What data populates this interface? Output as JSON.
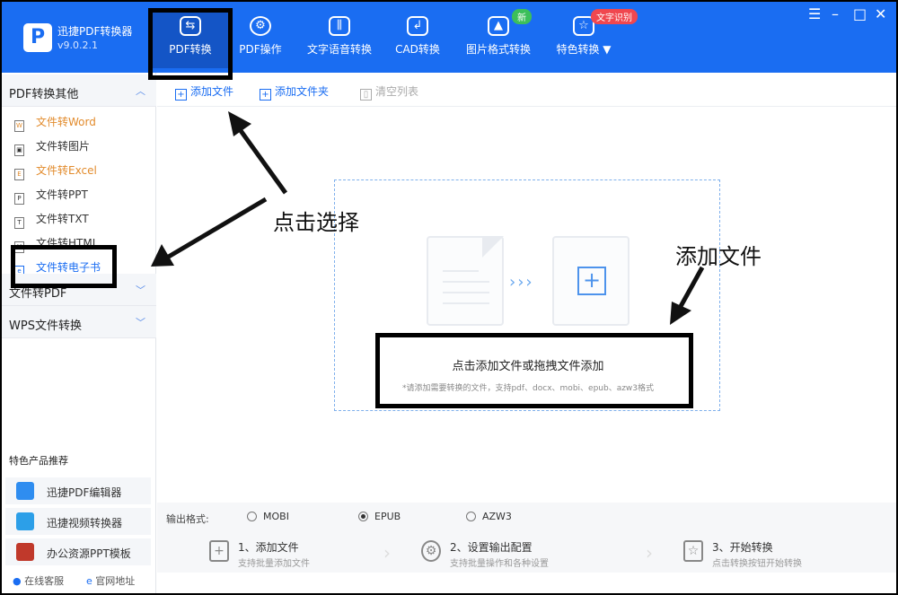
{
  "app": {
    "name": "迅捷PDF转换器",
    "version": "v9.0.2.1",
    "logo_letter": "P"
  },
  "nav": [
    {
      "label": "PDF转换",
      "icon": "convert-icon"
    },
    {
      "label": "PDF操作",
      "icon": "settings-icon"
    },
    {
      "label": "文字语音转换",
      "icon": "audio-wave-icon"
    },
    {
      "label": "CAD转换",
      "icon": "cad-icon"
    },
    {
      "label": "图片格式转换",
      "icon": "image-icon"
    },
    {
      "label": "特色转换",
      "icon": "star-icon"
    }
  ],
  "badges": {
    "new": "新",
    "ocr": "文字识别"
  },
  "window_controls": {
    "menu": "☰",
    "min": "–",
    "max": "□",
    "close": "✕"
  },
  "sidebar": {
    "group1": {
      "label": "PDF转换其他"
    },
    "items": [
      {
        "label": "文件转Word",
        "icon_letter": "W"
      },
      {
        "label": "文件转图片",
        "icon_letter": "▣"
      },
      {
        "label": "文件转Excel",
        "icon_letter": "E"
      },
      {
        "label": "文件转PPT",
        "icon_letter": "P"
      },
      {
        "label": "文件转TXT",
        "icon_letter": "T"
      },
      {
        "label": "文件转HTML",
        "icon_letter": "H"
      },
      {
        "label": "文件转电子书",
        "icon_letter": "e"
      }
    ],
    "group2": {
      "label": "文件转PDF"
    },
    "group3": {
      "label": "WPS文件转换"
    },
    "featured_title": "特色产品推荐",
    "products": [
      {
        "label": "迅捷PDF编辑器",
        "color": "#2f8df0"
      },
      {
        "label": "迅捷视频转换器",
        "color": "#2c9fe8"
      },
      {
        "label": "办公资源PPT模板",
        "color": "#c0392b"
      }
    ],
    "footer": {
      "service": "在线客服",
      "website": "官网地址"
    }
  },
  "toolbar": {
    "add_file": "添加文件",
    "add_folder": "添加文件夹",
    "clear_list": "清空列表"
  },
  "dropzone": {
    "arrows": "›››",
    "plus": "+",
    "main_hint": "点击添加文件或拖拽文件添加",
    "sub_hint": "*请添加需要转换的文件，支持pdf、docx、mobi、epub、azw3格式"
  },
  "output": {
    "label": "输出格式:",
    "options": [
      {
        "label": "MOBI",
        "selected": false
      },
      {
        "label": "EPUB",
        "selected": true
      },
      {
        "label": "AZW3",
        "selected": false
      }
    ]
  },
  "steps": [
    {
      "title": "1、添加文件",
      "desc": "支持批量添加文件"
    },
    {
      "title": "2、设置输出配置",
      "desc": "支持批量操作和各种设置"
    },
    {
      "title": "3、开始转换",
      "desc": "点击转换按钮开始转换"
    }
  ],
  "annotations": {
    "click_select": "点击选择",
    "add_file": "添加文件"
  }
}
